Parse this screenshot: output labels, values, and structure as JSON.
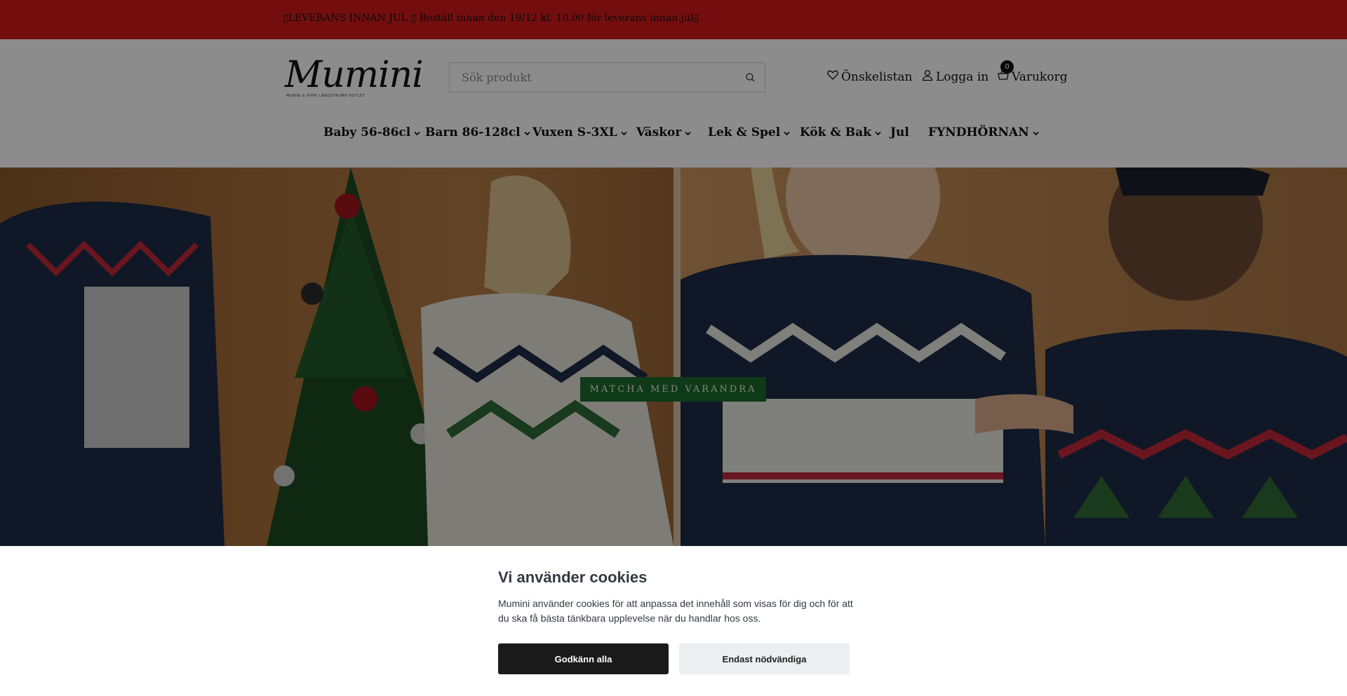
{
  "announcement": {
    "text": "▯LEVERANS INNAN JUL ▯ Beställ innan den 19/12 kl. 10.00 för leverans innan jul▯"
  },
  "brand": {
    "name": "Mumini",
    "tagline": "MUMIN & PIPPI LÅNGSTRUMP OUTLET",
    "color": "#111111"
  },
  "search": {
    "placeholder": "Sök produkt",
    "value": "",
    "icon": "search-icon"
  },
  "header_links": {
    "wishlist": {
      "label": "Önskelistan",
      "icon": "heart-icon"
    },
    "login": {
      "label": "Logga in",
      "icon": "user-icon"
    },
    "cart": {
      "label": "Varukorg",
      "icon": "basket-icon",
      "count": "0"
    }
  },
  "nav": {
    "items": [
      {
        "label": "Baby 56-86cl",
        "has_dropdown": true
      },
      {
        "label": "Barn 86-128cl",
        "has_dropdown": true
      },
      {
        "label": "Vuxen S-3XL",
        "has_dropdown": true
      },
      {
        "label": "Väskor",
        "has_dropdown": true
      },
      {
        "label": "Lek & Spel",
        "has_dropdown": true
      },
      {
        "label": "Kök & Bak",
        "has_dropdown": true
      },
      {
        "label": "Jul",
        "has_dropdown": false
      },
      {
        "label": "FYNDHÖRNAN",
        "has_dropdown": true
      }
    ]
  },
  "hero": {
    "cta_label": "MATCHA MED VARANDRA",
    "cta_color": "#1d6a2b"
  },
  "cookie_banner": {
    "title": "Vi använder cookies",
    "text": "Mumini använder cookies för att anpassa det innehåll som visas för dig och för att du ska få bästa tänkbara upplevelse när du handlar hos oss.",
    "accept_label": "Godkänn alla",
    "necessary_label": "Endast nödvändiga"
  },
  "colors": {
    "announcement_bg": "#d41a1b",
    "accept_button": "#1a1a1a",
    "necessary_button": "#eceef2"
  }
}
